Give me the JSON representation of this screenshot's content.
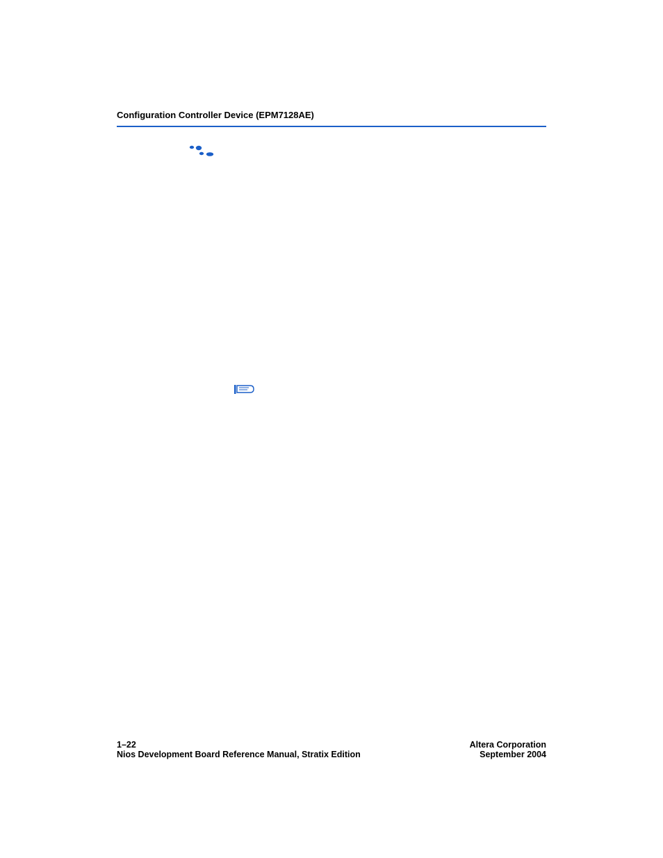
{
  "header": {
    "title": "Configuration Controller Device (EPM7128AE)"
  },
  "footer": {
    "page_number": "1–22",
    "manual_title": "Nios Development Board Reference Manual, Stratix Edition",
    "company": "Altera Corporation",
    "date": "September 2004"
  },
  "colors": {
    "accent": "#1b5fc8"
  }
}
